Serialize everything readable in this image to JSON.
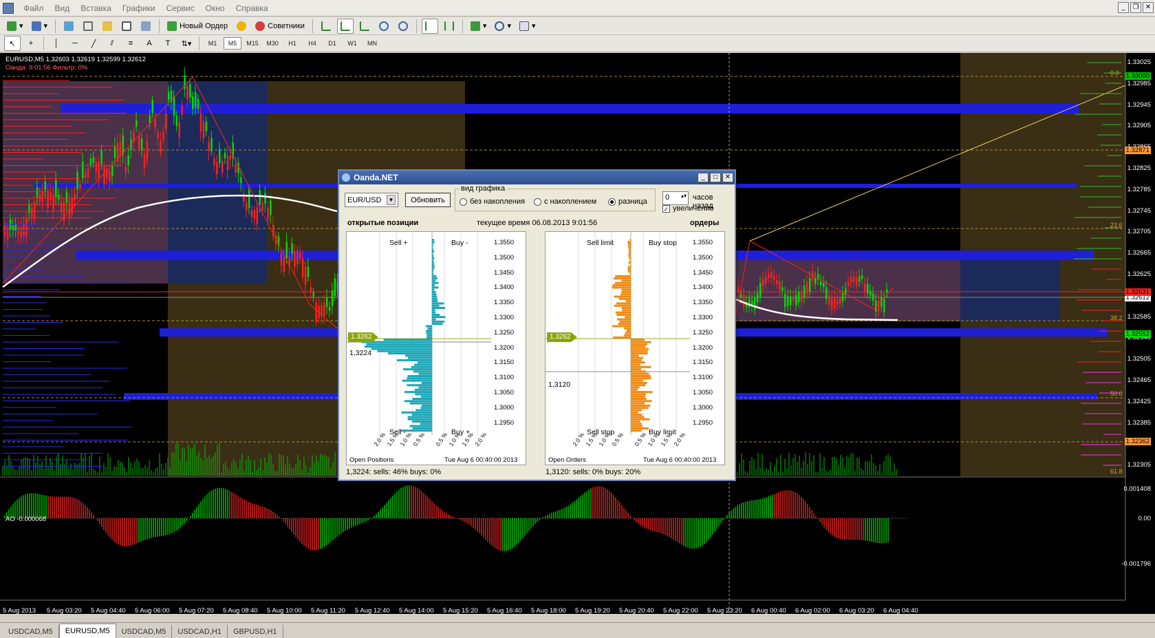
{
  "menu": {
    "items": [
      "Файл",
      "Вид",
      "Вставка",
      "Графики",
      "Сервис",
      "Окно",
      "Справка"
    ]
  },
  "toolbar": {
    "new_order": "Новый Ордер",
    "advisors": "Советники",
    "timeframes": [
      "M1",
      "M5",
      "M15",
      "M30",
      "H1",
      "H4",
      "D1",
      "W1",
      "MN"
    ],
    "active_timeframe": "M5"
  },
  "chart": {
    "header_line1": "EURUSD,M5  1.32603 1.32619 1.32599 1.32612",
    "header_line2": "Оанда: 9:01:56 Фильтр: 0%",
    "price_labels": [
      "1.33025",
      "1.32985",
      "1.32945",
      "1.32905",
      "1.32865",
      "1.32825",
      "1.32785",
      "1.32745",
      "1.32705",
      "1.32665",
      "1.32625",
      "1.32612",
      "1.32585",
      "1.32545",
      "1.32505",
      "1.32465",
      "1.32425",
      "1.32385",
      "1.32345",
      "1.32305"
    ],
    "highlight_labels": [
      {
        "text": "1.33000",
        "color": "#00c000"
      },
      {
        "text": "1.32871",
        "color": "#ff9933"
      },
      {
        "text": "1.32612",
        "color": "#ffffff"
      },
      {
        "text": "1.32631",
        "color": "#ff2020"
      },
      {
        "text": "1.32552",
        "color": "#00e000"
      },
      {
        "text": "1.32362",
        "color": "#ff9933"
      }
    ],
    "fib_labels": [
      "0.0",
      "23.6",
      "38.2",
      "50.0",
      "61.8"
    ],
    "ao_label": "AO -0.000068",
    "ao_scale": [
      "0.001408",
      "0.00",
      "-0.001796"
    ],
    "time_labels": [
      "5 Aug 2013",
      "5 Aug 03:20",
      "5 Aug 04:40",
      "5 Aug 06:00",
      "5 Aug 07:20",
      "5 Aug 08:40",
      "5 Aug 10:00",
      "5 Aug 11:20",
      "5 Aug 12:40",
      "5 Aug 14:00",
      "5 Aug 15:20",
      "5 Aug 16:40",
      "5 Aug 18:00",
      "5 Aug 19:20",
      "5 Aug 20:40",
      "5 Aug 22:00",
      "5 Aug 23:20",
      "6 Aug 00:40",
      "6 Aug 02:00",
      "6 Aug 03:20",
      "6 Aug 04:40"
    ]
  },
  "tabs": [
    "USDCAD,M5",
    "EURUSD,M5",
    "USDCAD,M5",
    "USDCAD,H1",
    "GBPUSD,H1"
  ],
  "active_tab": "EURUSD,M5",
  "dialog": {
    "title": "Oanda.NET",
    "pair": "EUR/USD",
    "refresh_label": "Обновить",
    "view_group_label": "вид графика",
    "radio_options": [
      "без накопления",
      "с накоплением",
      "разница"
    ],
    "selected_view": "разница",
    "hours_value": "0",
    "hours_label": "часов назад",
    "zoom_label": "увеличение",
    "zoom_checked": true,
    "open_positions_title": "открытые позиции",
    "current_time": "текущее время 06.08.2013 9:01:56",
    "orders_title": "ордеры",
    "scale": [
      "1.3550",
      "1.3500",
      "1.3450",
      "1.3400",
      "1.3350",
      "1.3300",
      "1.3250",
      "1.3200",
      "1.3150",
      "1.3100",
      "1.3050",
      "1.3000",
      "1.2950"
    ],
    "axis_ticks_left": [
      "2.0 %",
      "1.5 %",
      "1.0 %",
      "0.5 %"
    ],
    "axis_ticks_right": [
      "0.5 %",
      "1.0 %",
      "1.5 %",
      "2.0 %"
    ],
    "positions": {
      "current_price": "1.3262",
      "cursor_price": "1,3224",
      "quadrants": [
        "Sell +",
        "Buy -",
        "Sell -",
        "Buy +"
      ],
      "footer_left": "Open Positions",
      "footer_right": "Tue Aug  6 00:40:00 2013",
      "stat": "1,3224:  sells: 46%  buys: 0%"
    },
    "orders": {
      "current_price": "1.3262",
      "cursor_price": "1,3120",
      "quadrants": [
        "Sell limit",
        "Buy stop",
        "Sell stop",
        "Buy limit"
      ],
      "footer_left": "Open Orders",
      "footer_right": "Tue Aug  6 00:40:00 2013",
      "stat": "1,3120:  sells: 0%  buys: 20%"
    }
  },
  "colors": {
    "bull": "#00dd00",
    "bear": "#ff2020",
    "zone_blue": "#1f1fd8",
    "zone_brown": "#4a3a1a",
    "zone_purple": "#4a3048",
    "positions_bar": "#1aa6b7",
    "orders_bar": "#f08a12"
  }
}
